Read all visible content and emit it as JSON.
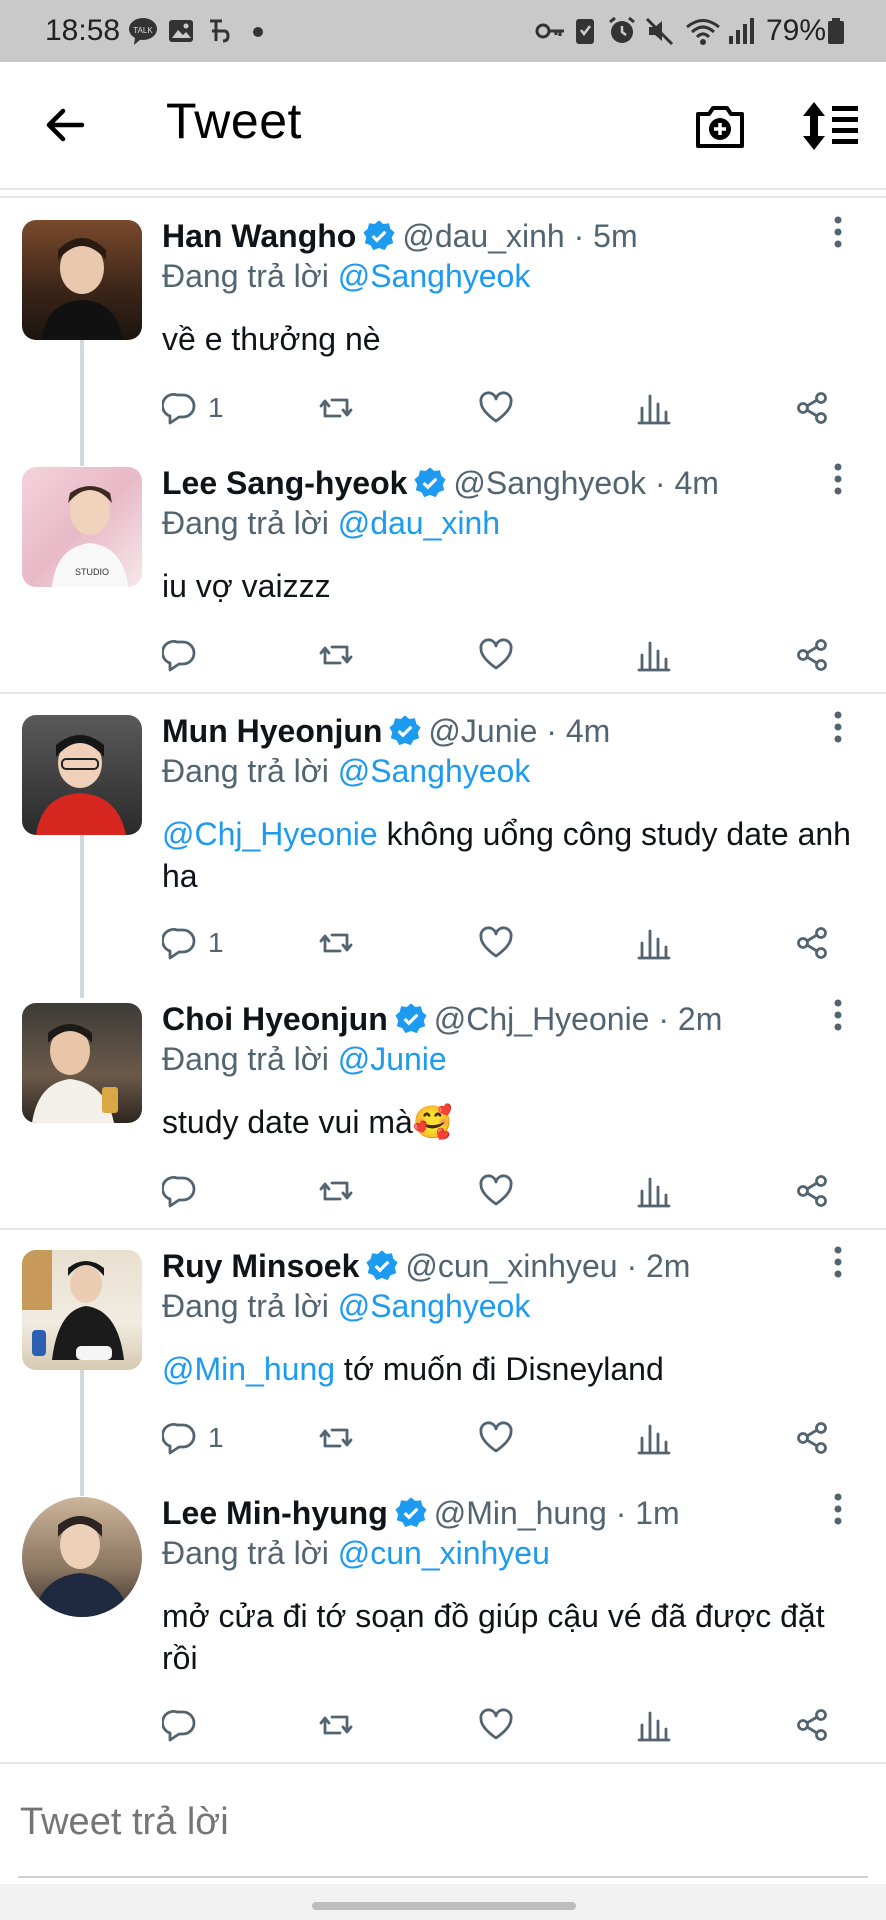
{
  "status_bar": {
    "time": "18:58",
    "battery": "79%",
    "notif_icons": [
      "talk-icon",
      "image-icon",
      "translate-icon",
      "dot-icon"
    ],
    "sys_icons": [
      "key-icon",
      "clipboard-icon",
      "alarm-icon",
      "mute-icon",
      "wifi-icon",
      "signal-icon",
      "battery-icon"
    ]
  },
  "header": {
    "title": "Tweet"
  },
  "colors": {
    "accent": "#1d9bf0",
    "secondary_text": "#536471",
    "primary_text": "#0f1419",
    "verified": "#1d9bf0"
  },
  "tweets": [
    {
      "name": "Han Wangho",
      "handle": "@dau_xinh",
      "sep": "·",
      "time": "5m",
      "reply_label": "Đang trả lời",
      "reply_to": "@Sanghyeok",
      "text_mention": "",
      "text": "về e thưởng nè",
      "reply_count": "1"
    },
    {
      "name": "Lee Sang-hyeok",
      "handle": "@Sanghyeok",
      "sep": "·",
      "time": "4m",
      "reply_label": "Đang trả lời",
      "reply_to": "@dau_xinh",
      "text_mention": "",
      "text": "iu vợ vaizzz",
      "reply_count": ""
    },
    {
      "name": "Mun Hyeonjun",
      "handle": "@Junie",
      "sep": "·",
      "time": "4m",
      "reply_label": "Đang trả lời",
      "reply_to": "@Sanghyeok",
      "text_mention": "@Chj_Hyeonie",
      "text": " không uổng công study date anh ha",
      "reply_count": "1"
    },
    {
      "name": "Choi Hyeonjun",
      "handle": "@Chj_Hyeonie",
      "sep": "·",
      "time": "2m",
      "reply_label": "Đang trả lời",
      "reply_to": "@Junie",
      "text_mention": "",
      "text": "study date vui mà🥰",
      "reply_count": ""
    },
    {
      "name": "Ruy Minsoek",
      "handle": "@cun_xinhyeu",
      "sep": "·",
      "time": "2m",
      "reply_label": "Đang trả lời",
      "reply_to": "@Sanghyeok",
      "text_mention": "@Min_hung",
      "text": " tớ muốn đi Disneyland",
      "reply_count": "1"
    },
    {
      "name": "Lee Min-hyung",
      "handle": "@Min_hung",
      "sep": "·",
      "time": "1m",
      "reply_label": "Đang trả lời",
      "reply_to": "@cun_xinhyeu",
      "text_mention": "",
      "text": "mở cửa đi tớ soạn đồ giúp cậu vé đã được đặt rồi",
      "reply_count": ""
    }
  ],
  "reply_box": {
    "placeholder": "Tweet trả lời"
  }
}
